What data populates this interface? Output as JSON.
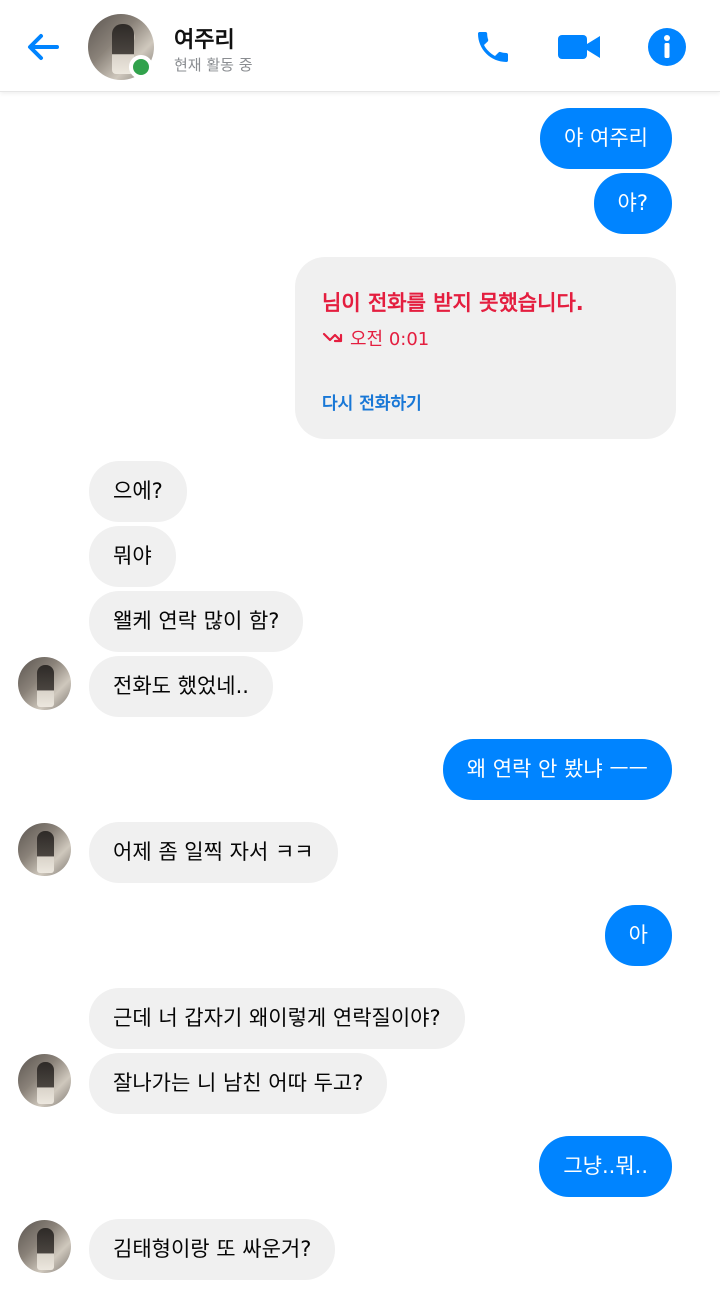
{
  "colors": {
    "accent": "#0084ff",
    "incoming_bubble": "#f0f0f0",
    "missed_call": "#e41e3f",
    "online": "#31a24c"
  },
  "header": {
    "contact_name": "여주리",
    "status": "현재 활동 중",
    "icons": [
      "back-arrow-icon",
      "phone-icon",
      "video-camera-icon",
      "info-icon"
    ]
  },
  "messages": [
    {
      "direction": "outgoing",
      "text": "야 여주리"
    },
    {
      "direction": "outgoing",
      "text": "야?"
    },
    {
      "direction": "outgoing",
      "type": "missed_call",
      "title": "님이 전화를 받지 못했습니다.",
      "time": "오전 0:01",
      "action": "다시 전화하기"
    },
    {
      "direction": "incoming",
      "text": "으에?"
    },
    {
      "direction": "incoming",
      "text": "뭐야"
    },
    {
      "direction": "incoming",
      "text": "왤케 연락 많이 함?"
    },
    {
      "direction": "incoming",
      "text": "전화도 했었네.."
    },
    {
      "direction": "outgoing",
      "text": "왜 연락 안 봤냐 ㅡㅡ"
    },
    {
      "direction": "incoming",
      "text": "어제 좀 일찍 자서 ㅋㅋ"
    },
    {
      "direction": "outgoing",
      "text": "아"
    },
    {
      "direction": "incoming",
      "text": "근데 너 갑자기 왜이렇게 연락질이야?"
    },
    {
      "direction": "incoming",
      "text": "잘나가는 니 남친 어따 두고?"
    },
    {
      "direction": "outgoing",
      "text": "그냥..뭐.."
    },
    {
      "direction": "incoming",
      "text": "김태형이랑 또 싸운거?"
    }
  ]
}
